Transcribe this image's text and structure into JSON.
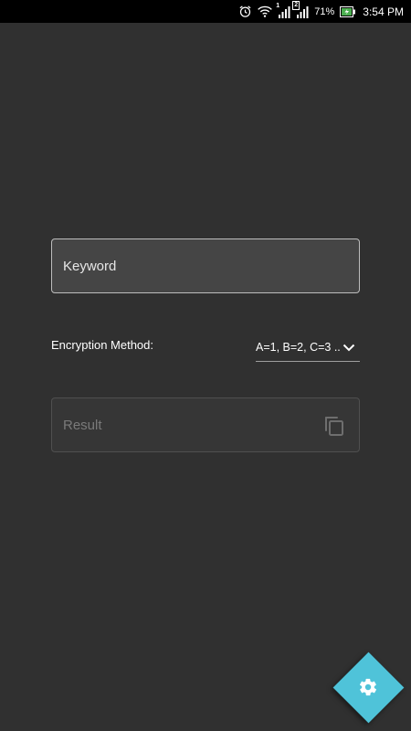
{
  "status_bar": {
    "icons": [
      "alarm-icon",
      "wifi-icon",
      "signal-sim1-icon",
      "signal-sim2-icon",
      "battery-charging-icon"
    ],
    "sim1_label": "1",
    "sim2_label": "2",
    "battery_percent": "71%",
    "time": "3:54 PM"
  },
  "form": {
    "keyword_placeholder": "Keyword",
    "keyword_value": "",
    "method_label": "Encryption Method:",
    "method_selected": "A=1, B=2, C=3 ..",
    "result_placeholder": "Result"
  },
  "icons": {
    "dropdown": "chevron-down-icon",
    "copy": "copy-icon",
    "settings": "gear-icon"
  },
  "colors": {
    "background": "#303030",
    "status_bar": "#000000",
    "fab": "#4fc3d9",
    "battery_charge": "#4caf50"
  }
}
